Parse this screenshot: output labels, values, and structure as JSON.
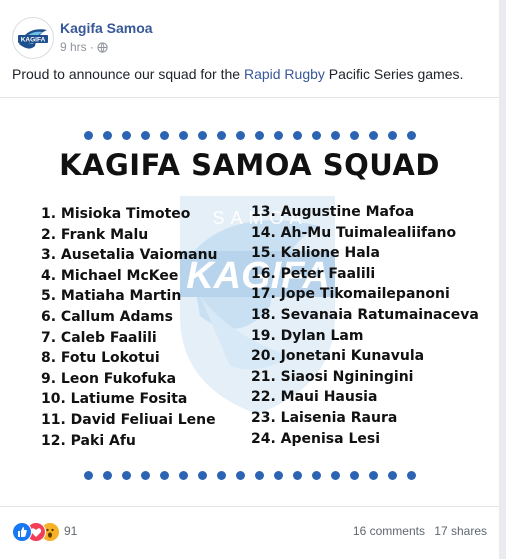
{
  "page": {
    "name": "Kagifa Samoa",
    "avatar_text": "KAGIFA",
    "time": "9 hrs",
    "separator": "·",
    "privacy_icon": "globe-icon"
  },
  "caption": {
    "before": "Proud to announce our squad for the ",
    "link": "Rapid Rugby",
    "after": " Pacific Series games."
  },
  "graphic": {
    "title": "KAGIFA SAMOA SQUAD",
    "watermark_top": "SAMOA",
    "watermark_main": "KAGIFA",
    "players_left": [
      "1. Misioka Timoteo",
      "2. Frank Malu",
      "3. Ausetalia Vaiomanu",
      "4. Michael McKee",
      "5. Matiaha Martin",
      "6. Callum Adams",
      "7. Caleb Faalili",
      "8. Fotu Lokotui",
      "9. Leon Fukofuka",
      "10. Latiume Fosita",
      "11. David Feliuai Lene",
      "12. Paki Afu"
    ],
    "players_right": [
      "13. Augustine Mafoa",
      "14. Ah-Mu Tuimalealiifano",
      "15. Kalione Hala",
      "16. Peter Faalili",
      "17. Jope Tikomailepanoni",
      "18. Sevanaia Ratumainaceva",
      "19. Dylan Lam",
      "20. Jonetani Kunavula",
      "21. Siaosi Nginingini",
      "22. Maui Hausia",
      "23. Laisenia Raura",
      "24. Apenisa Lesi"
    ]
  },
  "footer": {
    "reactions": [
      "like-icon",
      "love-icon",
      "wow-icon"
    ],
    "reaction_count": "91",
    "comments": "16 comments",
    "shares": "17 shares"
  },
  "colors": {
    "link": "#385898",
    "dots": "#2c64b3",
    "like": "#1877f2",
    "love": "#f33e58",
    "wow": "#f7b125"
  }
}
